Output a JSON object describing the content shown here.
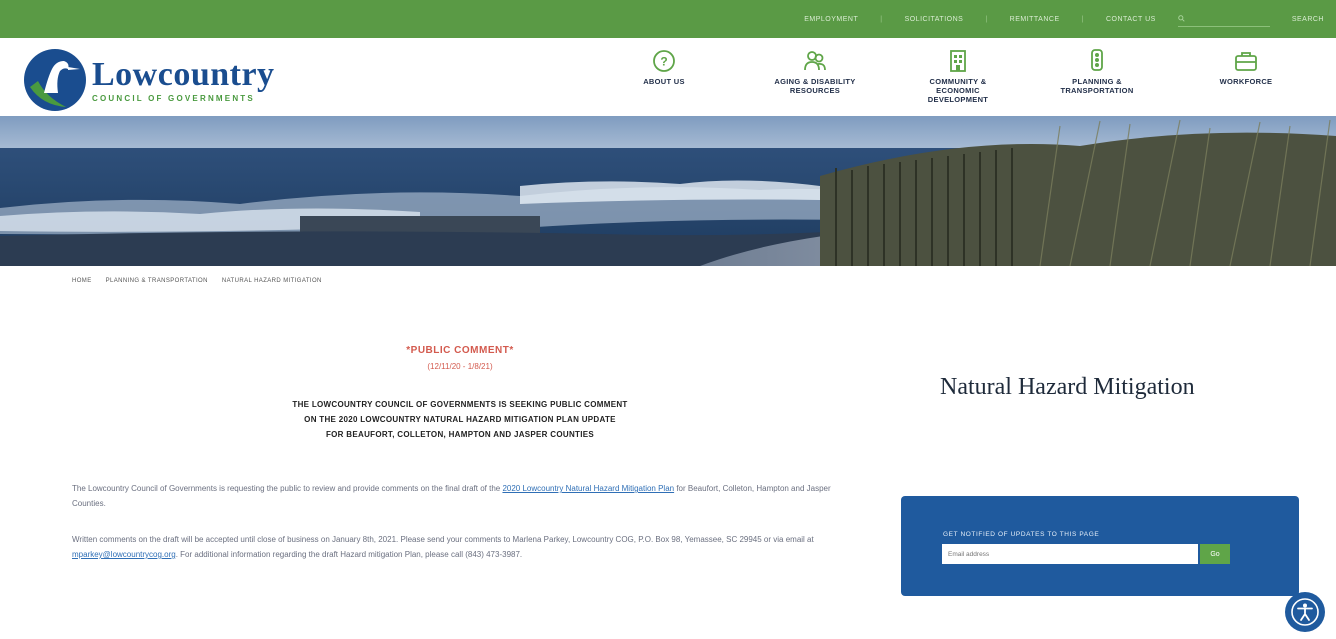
{
  "topbar": {
    "links": [
      "EMPLOYMENT",
      "SOLICITATIONS",
      "REMITTANCE",
      "CONTACT US"
    ],
    "search_placeholder": "",
    "search_label": "SEARCH"
  },
  "logo": {
    "title": "Lowcountry",
    "subtitle": "COUNCIL OF GOVERNMENTS"
  },
  "nav": [
    {
      "label": "ABOUT US",
      "icon": "question-circle-icon"
    },
    {
      "label": "AGING & DISABILITY RESOURCES",
      "icon": "people-icon"
    },
    {
      "label": "COMMUNITY & ECONOMIC DEVELOPMENT",
      "icon": "building-icon"
    },
    {
      "label": "PLANNING & TRANSPORTATION",
      "icon": "traffic-light-icon"
    },
    {
      "label": "WORKFORCE",
      "icon": "briefcase-icon"
    }
  ],
  "breadcrumb": [
    "HOME",
    "PLANNING & TRANSPORTATION",
    "NATURAL HAZARD MITIGATION"
  ],
  "notice": {
    "title": "*PUBLIC COMMENT*",
    "dates": "(12/11/20 - 1/8/21)",
    "heading_lines": [
      "THE LOWCOUNTRY COUNCIL OF GOVERNMENTS IS SEEKING PUBLIC COMMENT",
      "ON THE 2020 LOWCOUNTRY NATURAL HAZARD MITIGATION PLAN UPDATE",
      "FOR BEAUFORT, COLLETON, HAMPTON AND JASPER COUNTIES"
    ],
    "para1_pre": "The Lowcountry Council of Governments is requesting the public to review and provide comments on the final draft of the ",
    "para1_link": "2020 Lowcountry Natural Hazard Mitigation Plan",
    "para1_post": " for Beaufort, Colleton, Hampton and Jasper Counties.",
    "para2_pre": "Written comments on the draft will be accepted until close of business on January 8th, 2021. Please send your comments to Marlena Parkey, Lowcountry COG, P.O. Box 98, Yemassee, SC 29945 or via email at ",
    "para2_link": "mparkey@lowcountrycog.org",
    "para2_post": ". For additional information regarding the draft Hazard mitigation Plan, please call (843) 473-3987."
  },
  "sidebar": {
    "title": "Natural Hazard Mitigation",
    "notify_caption": "GET NOTIFIED OF UPDATES TO THIS PAGE",
    "email_placeholder": "Email address",
    "go_label": "Go"
  },
  "colors": {
    "topbar": "#5a9a45",
    "brand_blue": "#1a4d8f",
    "brand_green": "#4a9a3f",
    "notice_red": "#d35a4e",
    "panel_blue": "#1f5a9e"
  }
}
